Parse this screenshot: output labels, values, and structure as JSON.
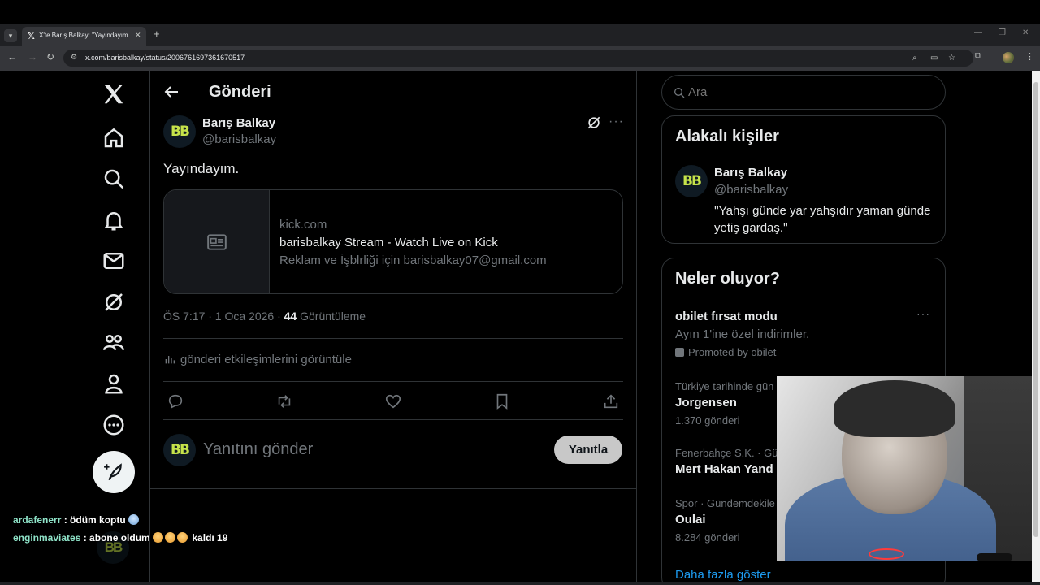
{
  "browser": {
    "tab_title": "X'te Barış Balkay: \"Yayındayım.\"",
    "url": "x.com/barisbalkay/status/2006761697361670517",
    "tab_icon": "x-logo-icon"
  },
  "page": {
    "title": "Gönderi"
  },
  "post": {
    "author_name": "Barış Balkay",
    "author_handle": "@barisbalkay",
    "avatar_text": "BB",
    "text": "Yayındayım.",
    "card": {
      "domain": "kick.com",
      "title": "barisbalkay Stream - Watch Live on Kick",
      "description": "Reklam ve İşblrliği için barisbalkay07@gmail.com"
    },
    "time": "ÖS 7:17 · 1 Oca 2026 · ",
    "views": "44",
    "views_label": " Görüntüleme",
    "engagements": "gönderi etkileşimlerini görüntüle",
    "reply_placeholder": "Yanıtını gönder",
    "reply_button": "Yanıtla"
  },
  "sidebar": {
    "search_placeholder": "Ara",
    "related_title": "Alakalı kişiler",
    "related": {
      "name": "Barış Balkay",
      "handle": "@barisbalkay",
      "bio": "''Yahşı günde yar yahşıdır yaman günde yetiş gardaş.''"
    },
    "trends_title": "Neler oluyor?",
    "trends": [
      {
        "name": "obilet fırsat modu",
        "subtitle": "Ayın 1'ine özel indirimler.",
        "promo": "Promoted by obilet"
      },
      {
        "category": "Türkiye tarihinde gün",
        "name": "Jorgensen",
        "count": "1.370 gönderi"
      },
      {
        "category": "Fenerbahçe S.K. · Gü",
        "name": "Mert Hakan Yand",
        "count": ""
      },
      {
        "category": "Spor · Gündemdekile",
        "name": "Oulai",
        "count": "8.284 gönderi"
      }
    ],
    "show_more": "Daha fazla göster"
  },
  "chat": [
    {
      "user": "ardafenerr",
      "message": " : ödüm koptu "
    },
    {
      "user": "enginmaviates",
      "message": " : abone oldum ",
      "tail": " kaldı 19"
    }
  ],
  "colors": {
    "accent": "#1d9bf0",
    "background": "#000000",
    "border": "#2f3336",
    "muted_text": "#71767b"
  }
}
